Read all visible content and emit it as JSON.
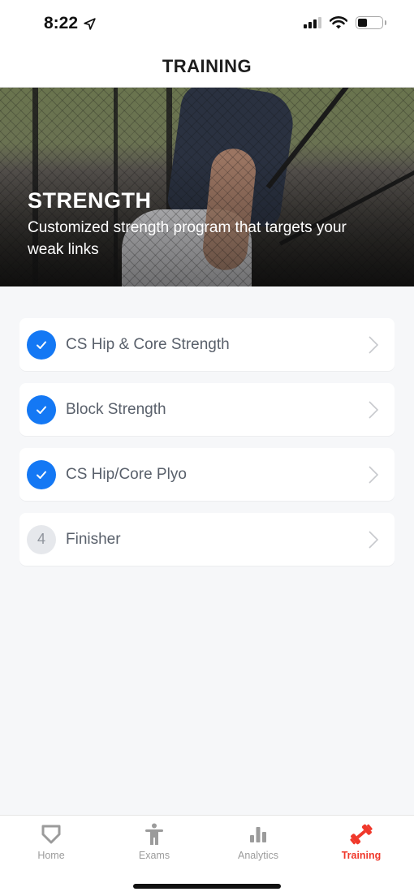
{
  "status_bar": {
    "time": "8:22",
    "location_icon": "location-arrow-icon",
    "signal_icon": "cellular-signal-icon",
    "wifi_icon": "wifi-icon",
    "battery_icon": "battery-icon",
    "battery_level_percent": 40
  },
  "header": {
    "title": "TRAINING"
  },
  "hero": {
    "title": "STRENGTH",
    "subtitle": "Customized strength program that targets your weak links",
    "image": "athlete-in-batting-cage-photo"
  },
  "workouts": [
    {
      "label": "CS Hip & Core Strength",
      "status": "completed",
      "badge_icon": "checkmark-icon",
      "chevron_icon": "chevron-right-icon"
    },
    {
      "label": "Block Strength",
      "status": "completed",
      "badge_icon": "checkmark-icon",
      "chevron_icon": "chevron-right-icon"
    },
    {
      "label": "CS Hip/Core Plyo",
      "status": "completed",
      "badge_icon": "checkmark-icon",
      "chevron_icon": "chevron-right-icon"
    },
    {
      "label": "Finisher",
      "status": "pending",
      "number": "4",
      "chevron_icon": "chevron-right-icon"
    }
  ],
  "tab_bar": {
    "items": [
      {
        "label": "Home",
        "icon": "home-plate-icon",
        "active": false
      },
      {
        "label": "Exams",
        "icon": "person-figure-icon",
        "active": false
      },
      {
        "label": "Analytics",
        "icon": "bar-chart-icon",
        "active": false
      },
      {
        "label": "Training",
        "icon": "dumbbell-icon",
        "active": true
      }
    ]
  },
  "colors": {
    "accent_blue": "#1478f4",
    "active_tab_red": "#f0382b",
    "inactive_tab_gray": "#9b9b9b",
    "background": "#f6f7f9"
  }
}
